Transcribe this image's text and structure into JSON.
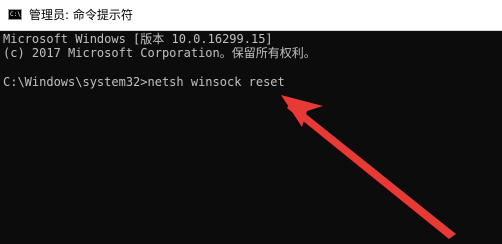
{
  "window": {
    "icon_label": "C:\\",
    "title": "管理员: 命令提示符"
  },
  "console": {
    "lines": [
      "Microsoft Windows [版本 10.0.16299.15]",
      "(c) 2017 Microsoft Corporation。保留所有权利。",
      "C:\\Windows\\system32>netsh winsock reset"
    ],
    "background_color": "#0c0c0c",
    "text_color": "#c0c0c0"
  },
  "annotation": {
    "arrow_color": "#e83a35",
    "icon": "red-arrow-icon"
  }
}
